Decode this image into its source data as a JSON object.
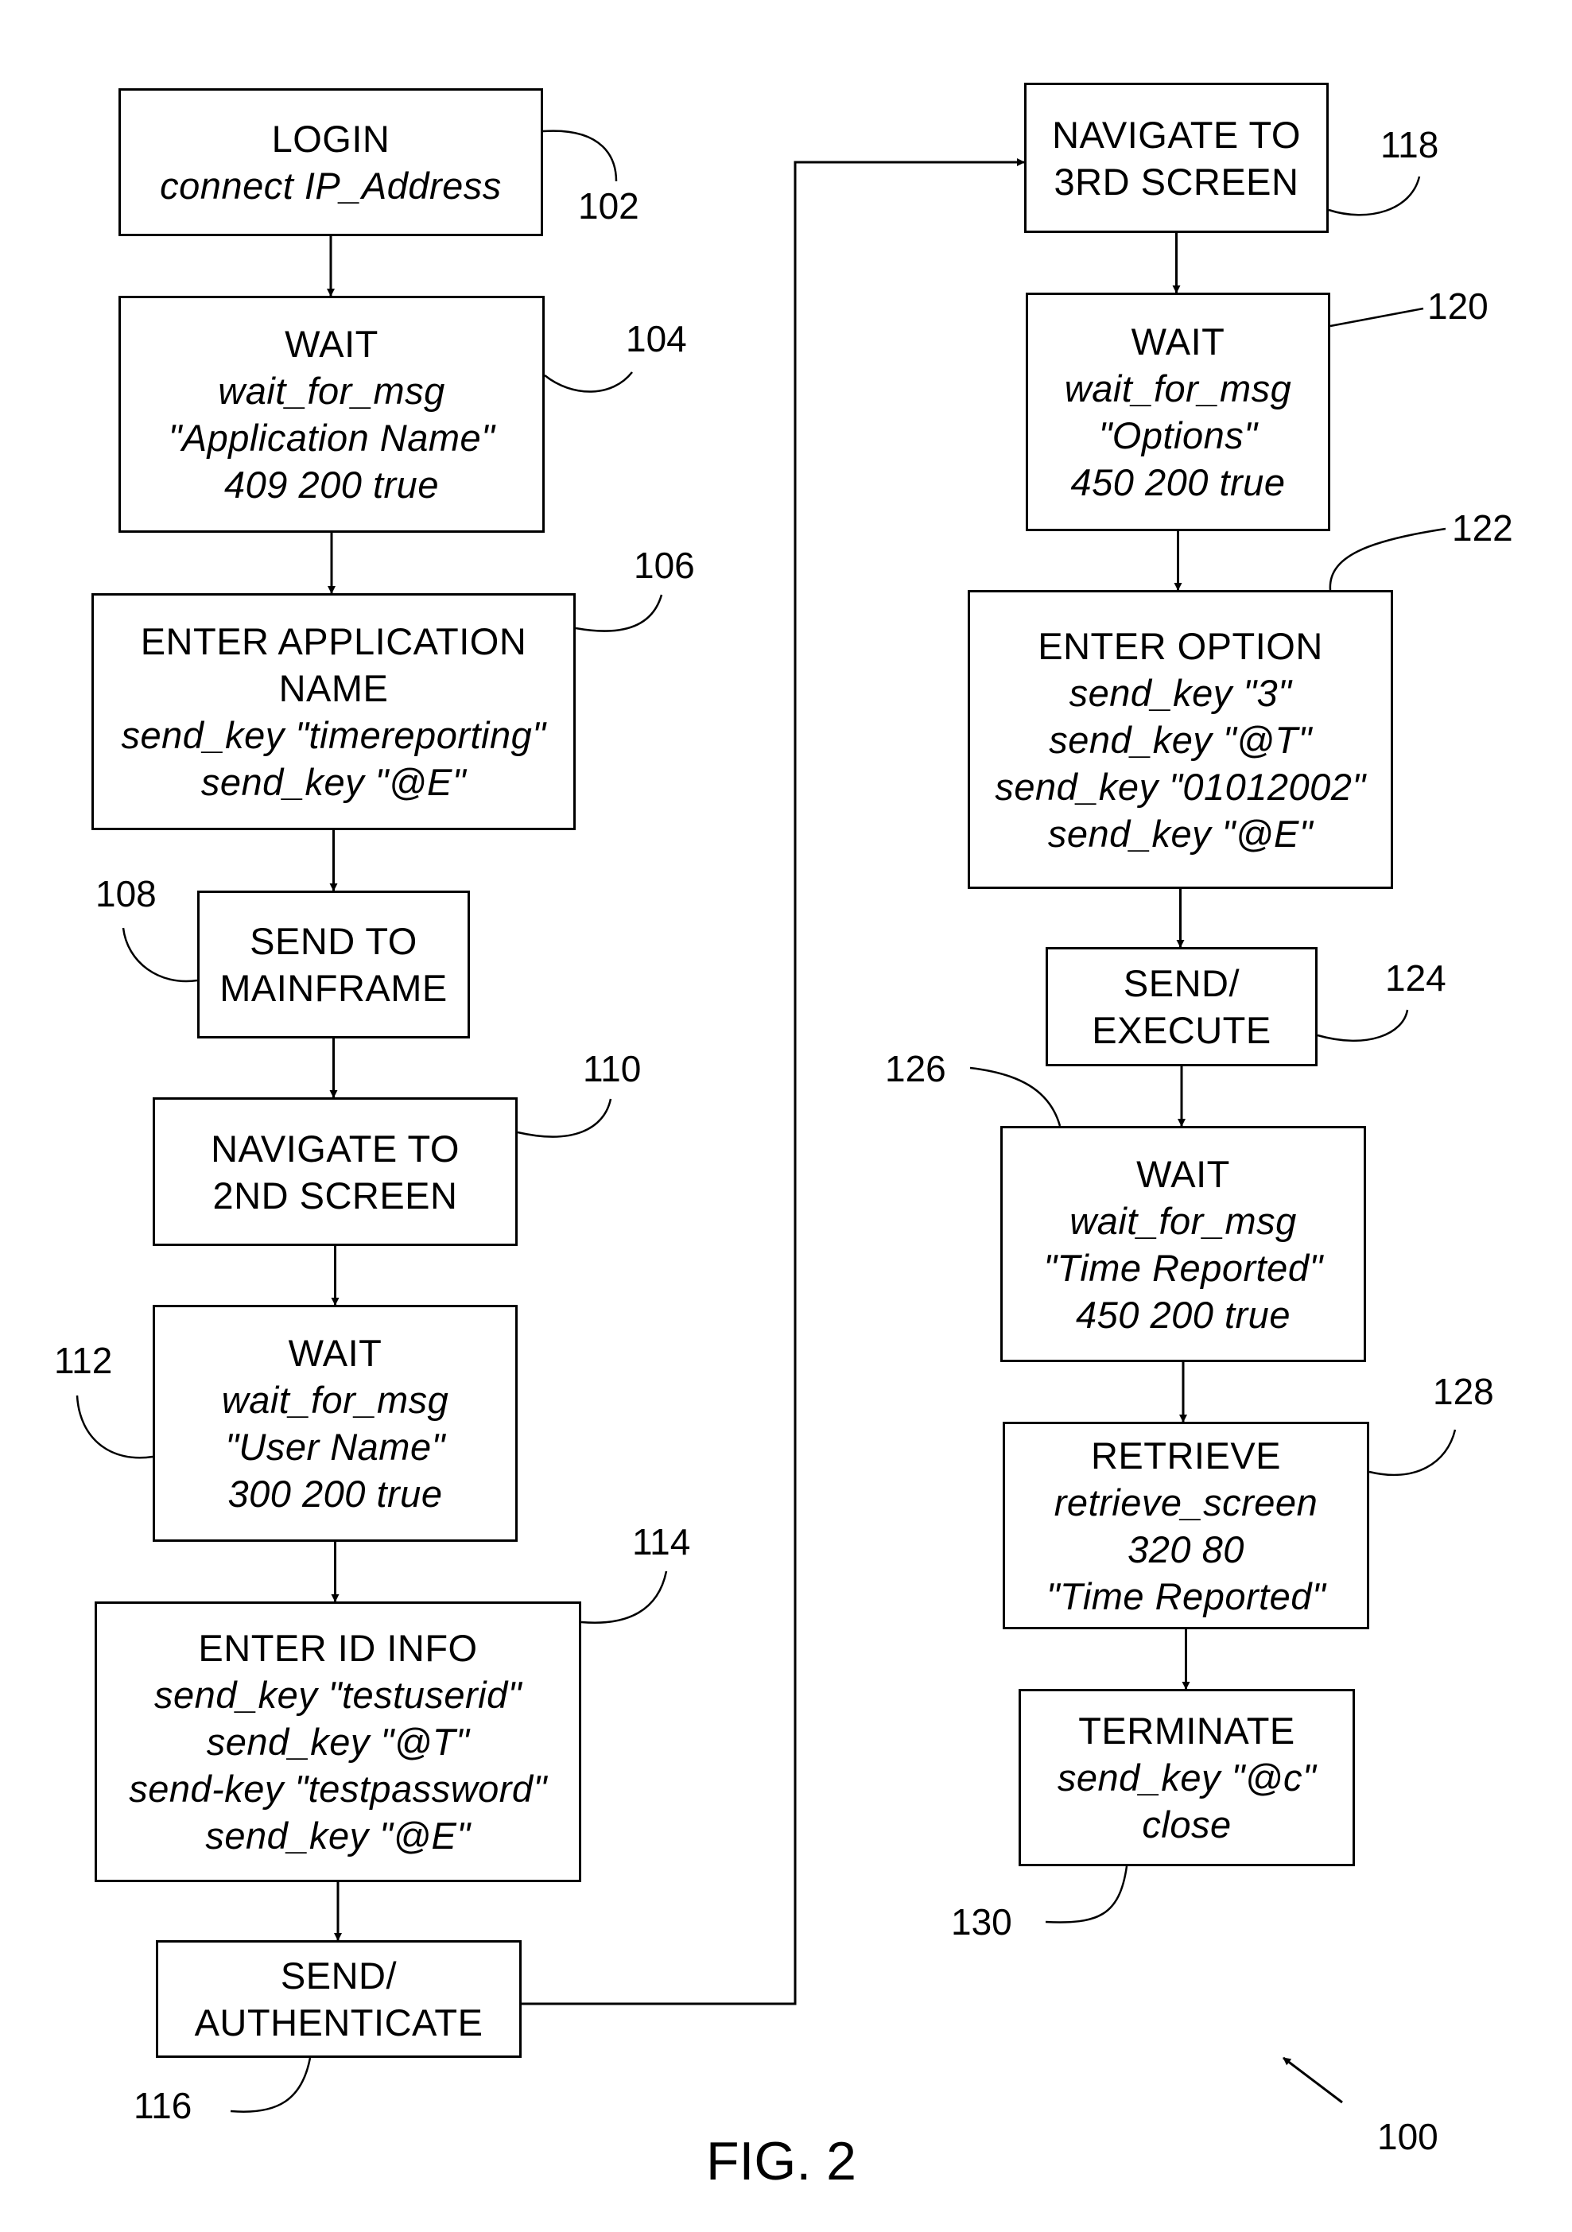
{
  "figure": {
    "caption": "FIG. 2",
    "reference": "100"
  },
  "steps": [
    {
      "id": "102",
      "title": [
        "LOGIN"
      ],
      "details": [
        "connect IP_Address"
      ]
    },
    {
      "id": "104",
      "title": [
        "WAIT"
      ],
      "details": [
        "wait_for_msg",
        "\"Application Name\"",
        "409 200 true"
      ]
    },
    {
      "id": "106",
      "title": [
        "ENTER APPLICATION",
        "NAME"
      ],
      "details": [
        "send_key \"timereporting\"",
        "send_key \"@E\""
      ]
    },
    {
      "id": "108",
      "title": [
        "SEND TO",
        "MAINFRAME"
      ],
      "details": []
    },
    {
      "id": "110",
      "title": [
        "NAVIGATE TO",
        "2ND SCREEN"
      ],
      "details": []
    },
    {
      "id": "112",
      "title": [
        "WAIT"
      ],
      "details": [
        "wait_for_msg",
        "\"User Name\"",
        "300 200 true"
      ]
    },
    {
      "id": "114",
      "title": [
        "ENTER ID INFO"
      ],
      "details": [
        "send_key \"testuserid\"",
        "send_key \"@T\"",
        "send-key \"testpassword\"",
        "send_key \"@E\""
      ]
    },
    {
      "id": "116",
      "title": [
        "SEND/",
        "AUTHENTICATE"
      ],
      "details": []
    },
    {
      "id": "118",
      "title": [
        "NAVIGATE TO",
        "3RD SCREEN"
      ],
      "details": []
    },
    {
      "id": "120",
      "title": [
        "WAIT"
      ],
      "details": [
        "wait_for_msg",
        "\"Options\"",
        "450 200 true"
      ]
    },
    {
      "id": "122",
      "title": [
        "ENTER OPTION"
      ],
      "details": [
        "send_key \"3\"",
        "send_key \"@T\"",
        "send_key \"01012002\"",
        "send_key \"@E\""
      ]
    },
    {
      "id": "124",
      "title": [
        "SEND/",
        "EXECUTE"
      ],
      "details": []
    },
    {
      "id": "126",
      "title": [
        "WAIT"
      ],
      "details": [
        "wait_for_msg",
        "\"Time Reported\"",
        "450 200 true"
      ]
    },
    {
      "id": "128",
      "title": [
        "RETRIEVE"
      ],
      "details": [
        "retrieve_screen",
        "320 80",
        "\"Time Reported\""
      ]
    },
    {
      "id": "130",
      "title": [
        "TERMINATE"
      ],
      "details": [
        "send_key \"@c\"",
        "close"
      ]
    }
  ],
  "flow": [
    "102",
    "104",
    "106",
    "108",
    "110",
    "112",
    "114",
    "116",
    "118",
    "120",
    "122",
    "124",
    "126",
    "128",
    "130"
  ]
}
